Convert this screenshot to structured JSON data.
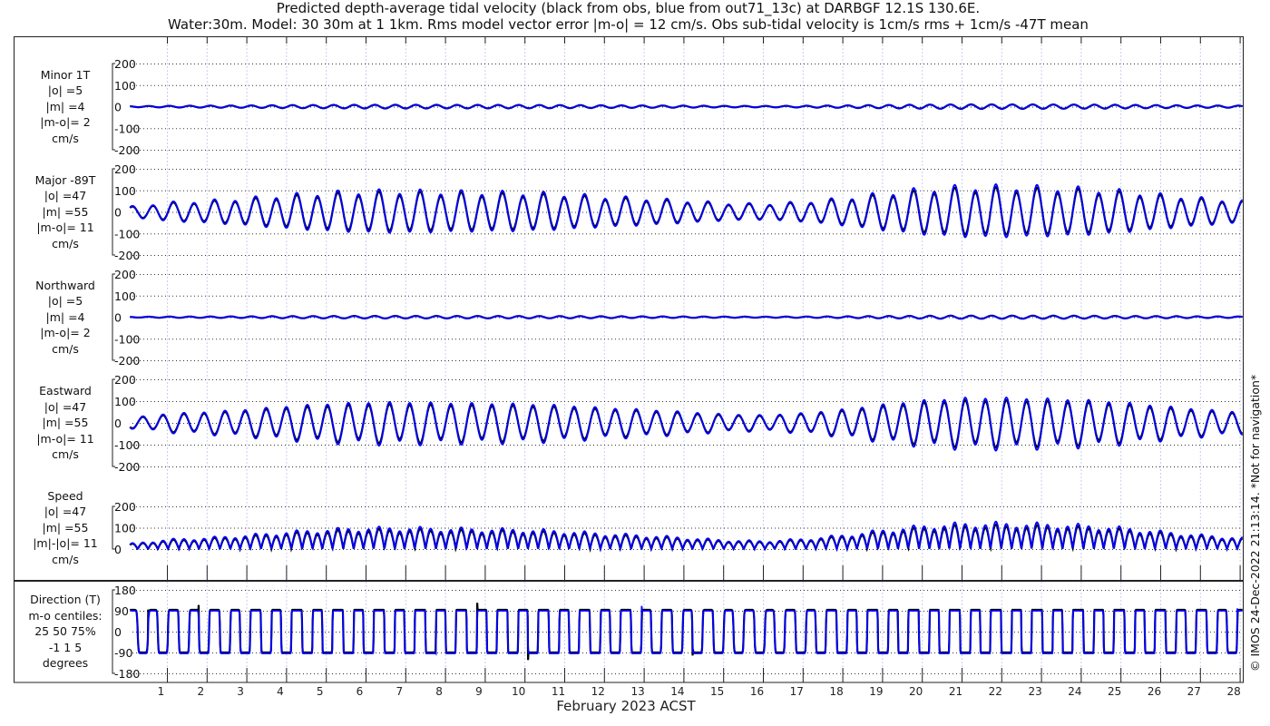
{
  "title_line1": "Predicted depth-average tidal velocity (black from obs, blue from out71_13c) at DARBGF 12.1S 130.6E.",
  "title_line2": "Water:30m. Model: 30 30m at 1 1km. Rms model vector error |m-o| = 12 cm/s. Obs sub-tidal velocity is 1cm/s rms + 1cm/s -47T mean",
  "copyright": "© IMOS 24-Dec-2022 21:13:14. *Not for navigation*",
  "colors": {
    "obs": "#000000",
    "model": "#0000ff",
    "grid_day": "#c9cff0"
  },
  "chart_data": {
    "type": "line",
    "xlabel": "February 2023 ACST",
    "x_ticks": [
      "1",
      "2",
      "3",
      "4",
      "5",
      "6",
      "7",
      "8",
      "9",
      "10",
      "11",
      "12",
      "13",
      "14",
      "15",
      "16",
      "17",
      "18",
      "19",
      "20",
      "21",
      "22",
      "23",
      "24",
      "25",
      "26",
      "27",
      "28"
    ],
    "xlim_days": [
      0.07,
      28.08
    ],
    "tidal_period_hours": 12.42,
    "major_amplitude_by_day_obs": [
      20,
      38,
      45,
      55,
      68,
      78,
      84,
      85,
      82,
      80,
      78,
      72,
      62,
      55,
      46,
      36,
      32,
      40,
      55,
      75,
      92,
      102,
      103,
      100,
      95,
      85,
      70,
      56,
      45
    ],
    "model_scale": 1.12,
    "panels": [
      {
        "id": "minor",
        "lines": [
          "Minor 1T",
          "|o| =5",
          "|m| =4",
          "|m-o|= 2",
          "cm/s"
        ],
        "yticks": [
          "200",
          "100",
          "0",
          "-100",
          "-200"
        ],
        "ylim": [
          -200,
          200
        ],
        "amp_ratio": 0.1
      },
      {
        "id": "major",
        "lines": [
          "Major -89T",
          "|o| =47",
          "|m| =55",
          "|m-o|= 11",
          "cm/s"
        ],
        "yticks": [
          "200",
          "100",
          "0",
          "-100",
          "-200"
        ],
        "ylim": [
          -200,
          200
        ],
        "amp_ratio": 1
      },
      {
        "id": "north",
        "lines": [
          "Northward",
          "|o| =5",
          "|m| =4",
          "|m-o|= 2",
          "cm/s"
        ],
        "yticks": [
          "200",
          "100",
          "0",
          "-100",
          "-200"
        ],
        "ylim": [
          -200,
          200
        ],
        "amp_ratio": 0.07
      },
      {
        "id": "east",
        "lines": [
          "Eastward",
          "|o| =47",
          "|m| =55",
          "|m-o|= 11",
          "cm/s"
        ],
        "yticks": [
          "200",
          "100",
          "0",
          "-100",
          "-200"
        ],
        "ylim": [
          -200,
          200
        ],
        "amp_ratio": 1
      },
      {
        "id": "speed",
        "lines": [
          "Speed",
          "|o| =47",
          "|m| =55",
          "|m|-|o|= 11",
          "cm/s"
        ],
        "yticks": [
          "200",
          "100",
          "0"
        ],
        "ylim": [
          0,
          200
        ],
        "amp_ratio": 1
      },
      {
        "id": "direction",
        "lines": [
          "Direction (T)",
          "m-o centiles:",
          "25  50  75%",
          "-1  1  5",
          "degrees"
        ],
        "yticks": [
          "180",
          "90",
          "0",
          "-90",
          "-180"
        ],
        "ylim": [
          -180,
          180
        ],
        "amp_ratio": 1
      }
    ]
  }
}
